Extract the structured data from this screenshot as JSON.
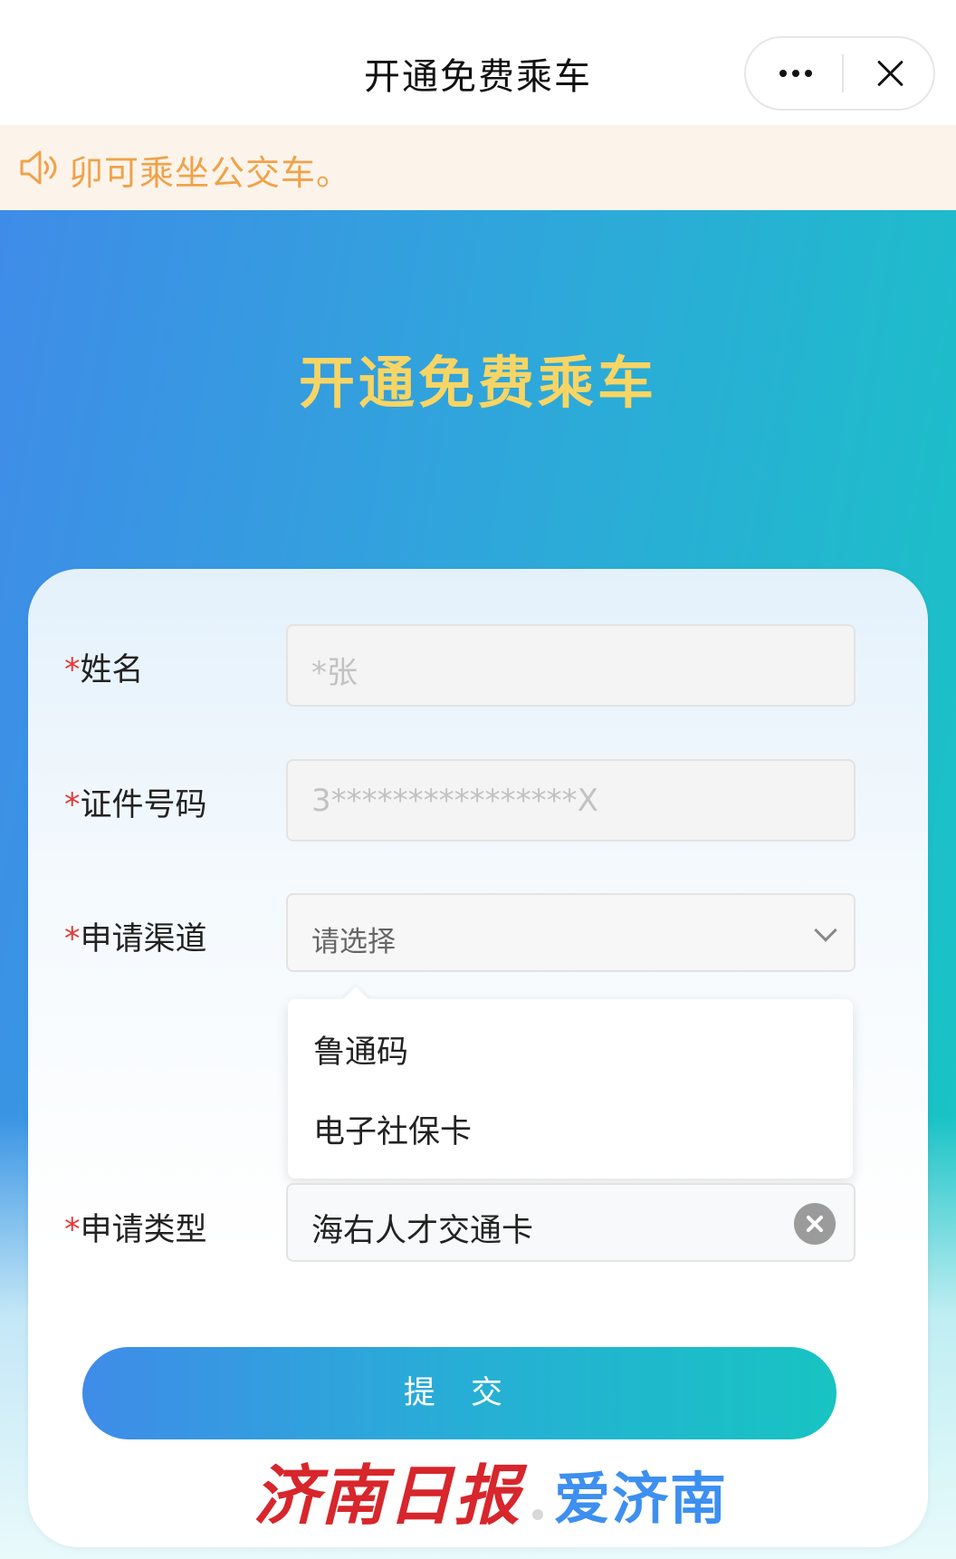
{
  "titlebar": {
    "title": "开通免费乘车",
    "more_icon": "more-dots-icon",
    "close_icon": "close-icon"
  },
  "notice": {
    "icon": "speaker-icon",
    "text": "卯可乘坐公交车。"
  },
  "hero": {
    "title": "开通免费乘车"
  },
  "form": {
    "name": {
      "required_mark": "*",
      "label": "姓名",
      "value": "*张"
    },
    "id_number": {
      "required_mark": "*",
      "label": "证件号码",
      "value": "3****************X"
    },
    "channel": {
      "required_mark": "*",
      "label": "申请渠道",
      "placeholder": "请选择",
      "options": [
        "鲁通码",
        "电子社保卡"
      ]
    },
    "type": {
      "required_mark": "*",
      "label": "申请类型",
      "value": "海右人才交通卡"
    },
    "submit_label": "提 交"
  },
  "watermark": {
    "left": "济南日报",
    "right": "爱济南"
  },
  "colors": {
    "accent_blue": "#3f8ce8",
    "accent_teal": "#16c7c3",
    "hero_title": "#f7d564",
    "notice_text": "#f0a24a",
    "required": "#e53935"
  }
}
